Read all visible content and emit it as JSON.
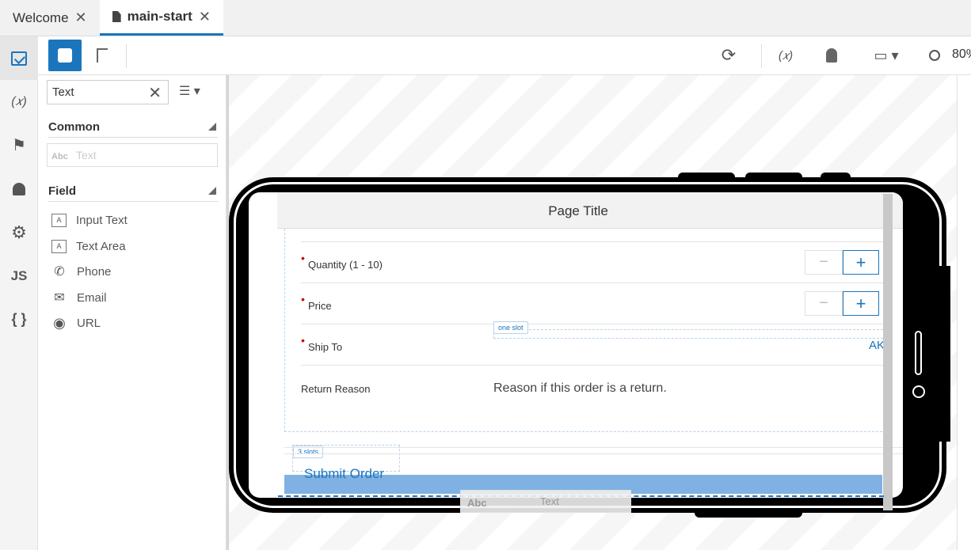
{
  "tabs": [
    {
      "label": "Welcome",
      "active": false
    },
    {
      "label": "main-start",
      "active": true
    }
  ],
  "rail": {
    "items": [
      {
        "icon": "components-icon"
      },
      {
        "icon": "variables-icon",
        "glyph": "(𝑥)"
      },
      {
        "icon": "flag-icon",
        "glyph": "⚑"
      },
      {
        "icon": "bell-icon",
        "glyph": "🔔"
      },
      {
        "icon": "gear-icon",
        "glyph": "⚙"
      },
      {
        "icon": "js-icon",
        "glyph": "JS"
      },
      {
        "icon": "json-icon",
        "glyph": "{ }"
      }
    ]
  },
  "toolbar": {
    "zoom": "80%",
    "reload_glyph": "⟳",
    "variables_glyph": "(𝑥)",
    "device_glyph": "▭ ▾",
    "search_glyph": "🔍"
  },
  "palette": {
    "search_value": "Text",
    "sections": {
      "common": "Common",
      "field": "Field"
    },
    "common_items": [
      {
        "label": "Text",
        "icon_text": "Abc"
      }
    ],
    "field_items": [
      {
        "label": "Input Text",
        "icon": "input-text-icon",
        "glyph": "A"
      },
      {
        "label": "Text Area",
        "icon": "text-area-icon",
        "glyph": "A"
      },
      {
        "label": "Phone",
        "icon": "phone-icon",
        "glyph": "✆"
      },
      {
        "label": "Email",
        "icon": "email-icon",
        "glyph": "✉"
      },
      {
        "label": "URL",
        "icon": "url-icon",
        "glyph": "◉"
      }
    ]
  },
  "page": {
    "title": "Page Title",
    "rows": [
      {
        "label": "Quantity (1 - 10)",
        "required": true,
        "control": "stepper"
      },
      {
        "label": "Price",
        "required": true,
        "control": "stepper"
      },
      {
        "label": "Ship To",
        "required": true,
        "control": "link",
        "value": "AK"
      },
      {
        "label": "Return Reason",
        "required": false,
        "control": "text",
        "value": "Reason if this order is a return."
      }
    ],
    "stepper": {
      "minus": "−",
      "plus": "+"
    },
    "slot_one": "one slot",
    "slot_three": "3 slots",
    "submit_label": "Submit Order",
    "drag_ghost": {
      "icon_text": "Abc",
      "label": "Text"
    }
  },
  "colors": {
    "accent": "#1b75bc",
    "submit_bar": "#7fb1e3"
  }
}
